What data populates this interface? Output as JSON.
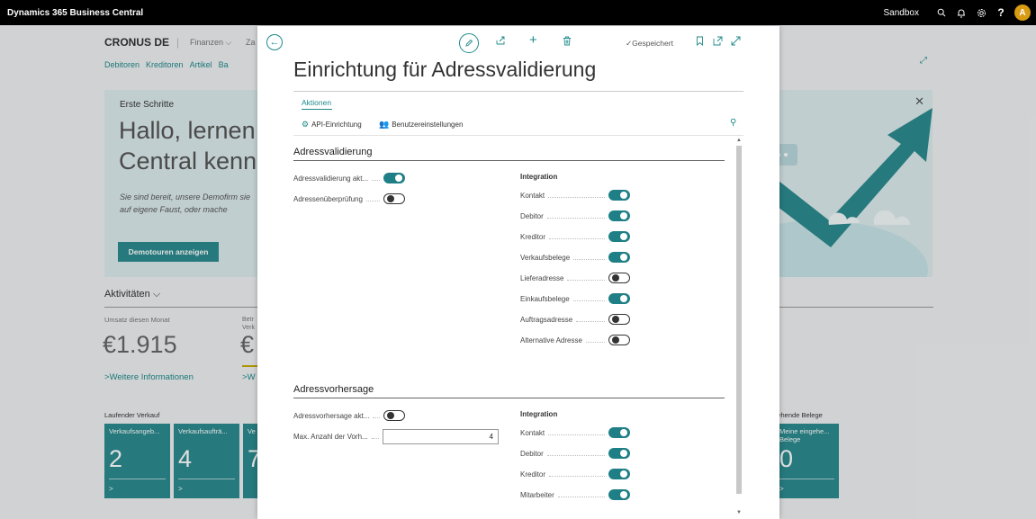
{
  "topbar": {
    "app_title": "Dynamics 365 Business Central",
    "environment": "Sandbox",
    "avatar_initial": "A"
  },
  "background": {
    "company": "CRONUS DE",
    "menu": [
      "Finanzen",
      "Za"
    ],
    "nav_links": [
      "Debitoren",
      "Kreditoren",
      "Artikel",
      "Ba"
    ],
    "banner": {
      "eyebrow": "Erste Schritte",
      "headline": "Hallo, lernen Central kenn",
      "description": "Sie sind bereit, unsere Demofirm sie auf eigene Faust, oder mache",
      "tour_button": "Demotouren anzeigen"
    },
    "activities": {
      "title": "Aktivitäten",
      "kpi1_label": "Umsatz diesen Monat",
      "kpi1_value": "€1.915",
      "kpi2_label": "Betr Verk",
      "kpi2_value": "€",
      "more_link": "Weitere Informationen",
      "more_link2": "W"
    },
    "sales": {
      "title": "Laufender Verkauf",
      "tiles": [
        {
          "label": "Verkaufsangeb...",
          "value": "2"
        },
        {
          "label": "Verkaufsaufträ...",
          "value": "4"
        },
        {
          "label": "Ve",
          "value": "7"
        }
      ]
    },
    "incoming": {
      "title": "ngehende Belege",
      "tile_label": "Meine eingehe... Belege",
      "tile_value": "0"
    }
  },
  "dialog": {
    "title": "Einrichtung für Adressvalidierung",
    "saved_label": "Gespeichert",
    "actions_tab": "Aktionen",
    "actions": [
      {
        "label": "API-Einrichtung",
        "icon": "api-setup-icon"
      },
      {
        "label": "Benutzereinstellungen",
        "icon": "users-icon"
      }
    ],
    "section1": {
      "title": "Adressvalidierung",
      "fields": [
        {
          "label": "Adressvalidierung akt...",
          "on": true
        },
        {
          "label": "Adressenüberprüfung",
          "on": false
        }
      ],
      "integration_title": "Integration",
      "integration": [
        {
          "label": "Kontakt",
          "on": true
        },
        {
          "label": "Debitor",
          "on": true
        },
        {
          "label": "Kreditor",
          "on": true
        },
        {
          "label": "Verkaufsbelege",
          "on": true
        },
        {
          "label": "Lieferadresse",
          "on": false
        },
        {
          "label": "Einkaufsbelege",
          "on": true
        },
        {
          "label": "Auftragsadresse",
          "on": false
        },
        {
          "label": "Alternative Adresse",
          "on": false
        }
      ]
    },
    "section2": {
      "title": "Adressvorhersage",
      "toggle_field": {
        "label": "Adressvorhersage akt...",
        "on": false
      },
      "number_field": {
        "label": "Max. Anzahl der Vorh...",
        "value": "4"
      },
      "integration_title": "Integration",
      "integration": [
        {
          "label": "Kontakt",
          "on": true
        },
        {
          "label": "Debitor",
          "on": true
        },
        {
          "label": "Kreditor",
          "on": true
        },
        {
          "label": "Mitarbeiter",
          "on": true
        }
      ]
    }
  },
  "colors": {
    "accent": "#1f8a8a",
    "toggle_on": "#1f7f86",
    "tile": "#2c8a8e",
    "topbar": "#000000"
  }
}
